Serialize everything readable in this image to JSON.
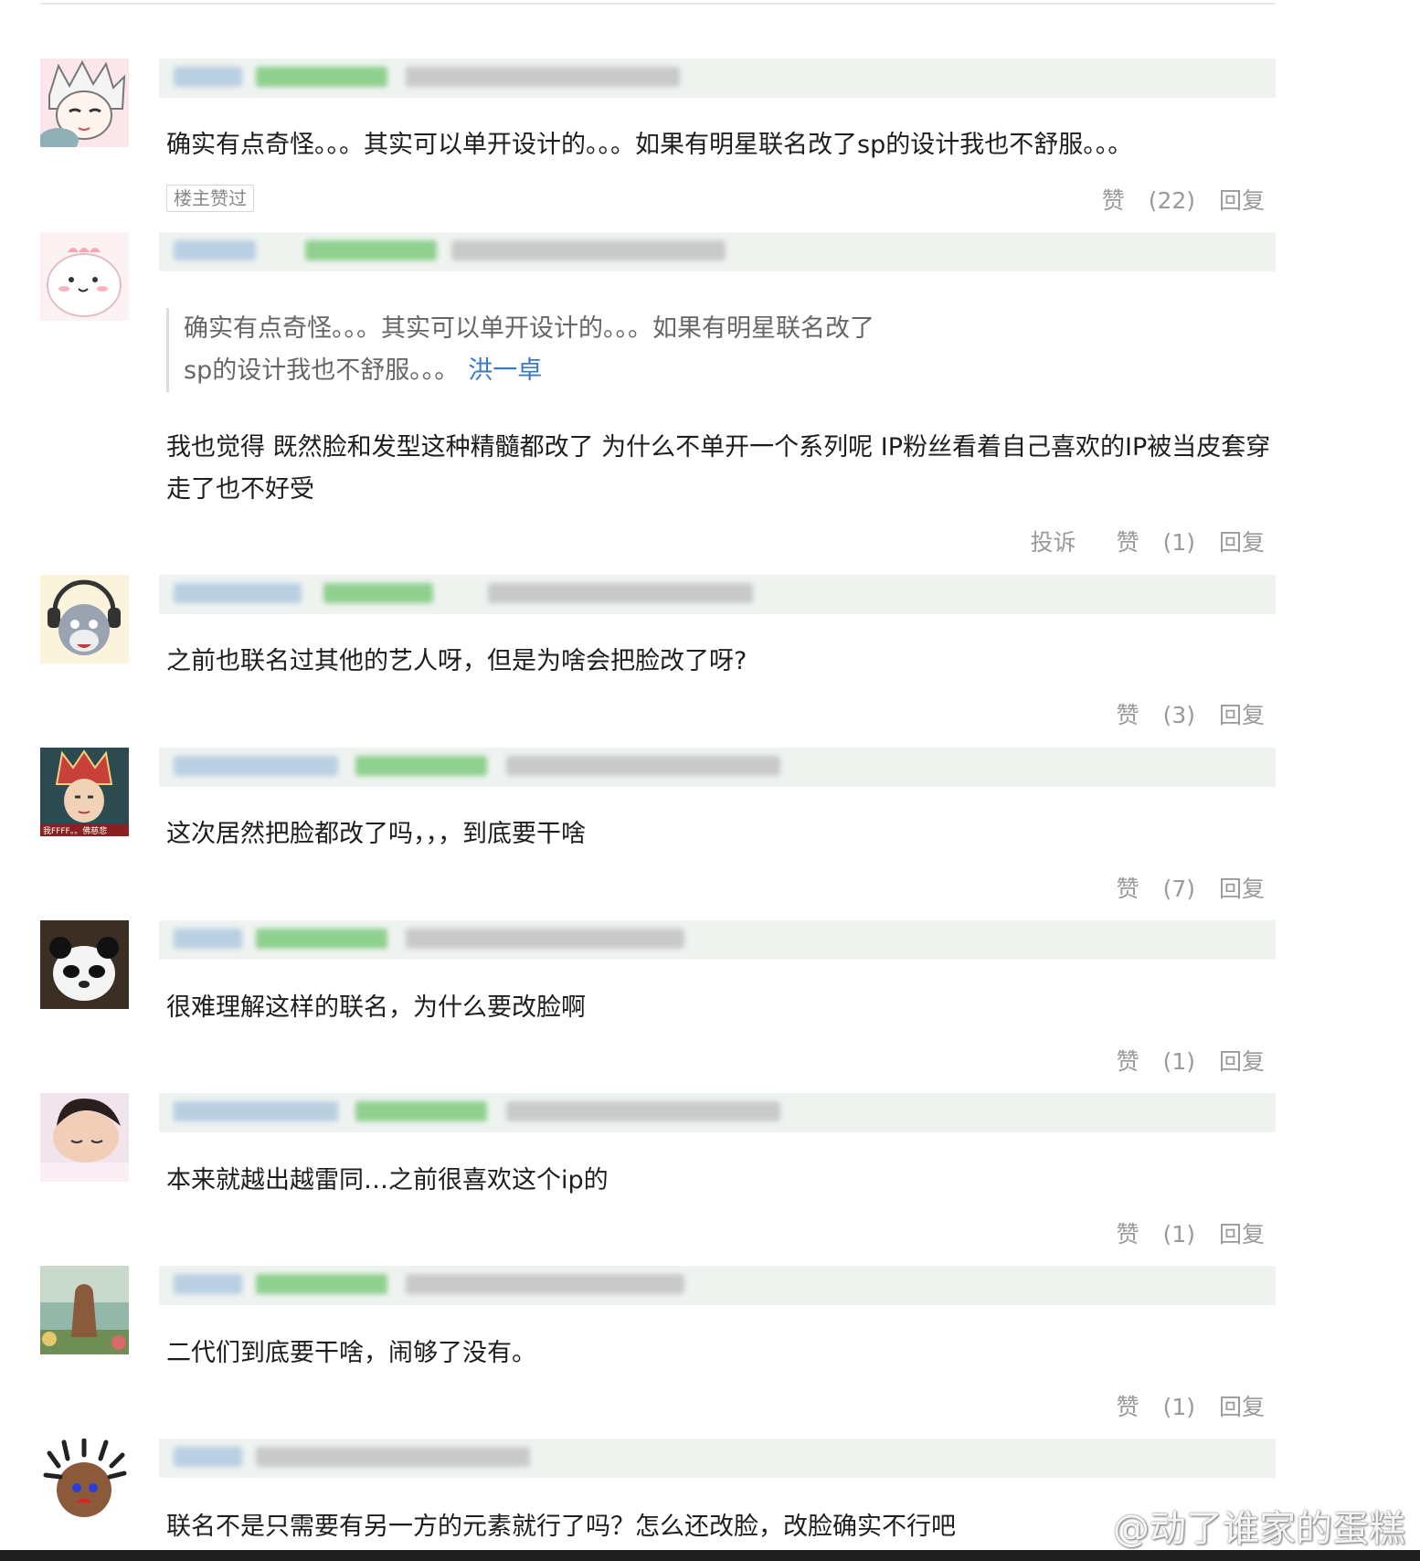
{
  "actions_label": {
    "complain": "投诉",
    "like": "赞",
    "reply": "回复"
  },
  "comments": [
    {
      "text": "确实有点奇怪。。。其实可以单开设计的。。。如果有明星联名改了sp的设计我也不舒服。。。",
      "badge": "楼主赞过",
      "likes": "22"
    },
    {
      "quote_line1": "确实有点奇怪。。。其实可以单开设计的。。。如果有明星联名改了",
      "quote_line2": "sp的设计我也不舒服。。。",
      "quote_author": "洪一卓",
      "text": "我也觉得 既然脸和发型这种精髓都改了 为什么不单开一个系列呢 IP粉丝看着自己喜欢的IP被当皮套穿走了也不好受",
      "likes": "1"
    },
    {
      "text": "之前也联名过其他的艺人呀，但是为啥会把脸改了呀?",
      "likes": "3"
    },
    {
      "text": "这次居然把脸都改了吗，，，到底要干啥",
      "likes": "7",
      "avatar_caption": "我FFFF。。佛慈悲"
    },
    {
      "text": "很难理解这样的联名，为什么要改脸啊",
      "likes": "1"
    },
    {
      "text": "本来就越出越雷同…之前很喜欢这个ip的",
      "likes": "1"
    },
    {
      "text": "二代们到底要干啥，闹够了没有。",
      "likes": "1"
    },
    {
      "text": "联名不是只需要有另一方的元素就行了吗？怎么还改脸，改脸确实不行吧"
    }
  ],
  "watermark": "@动了谁家的蛋糕",
  "icons": [
    "weibo-logo-icon"
  ]
}
